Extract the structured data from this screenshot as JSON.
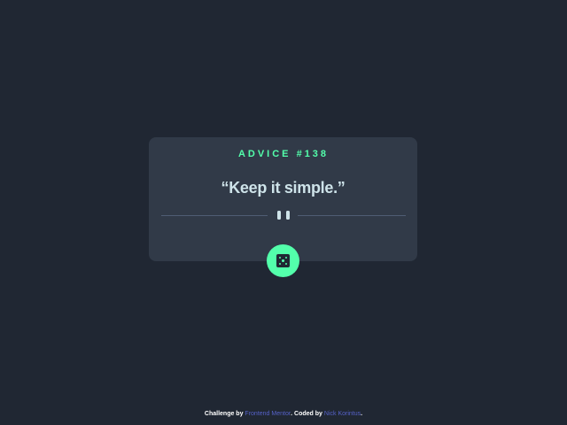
{
  "card": {
    "advice_label": "ADVICE #138",
    "quote": "“Keep it simple.”"
  },
  "dice_button": {
    "icon": "dice-icon"
  },
  "footer": {
    "prefix": "Challenge by ",
    "link1": "Frontend Mentor",
    "middle": ". Coded by ",
    "link2": "Nick Korintus",
    "suffix": "."
  },
  "colors": {
    "background": "#202733",
    "card": "#313A48",
    "accent": "#53FFAB",
    "text": "#CEE3E9",
    "divider": "#4F5D74",
    "link": "#5561C7"
  }
}
